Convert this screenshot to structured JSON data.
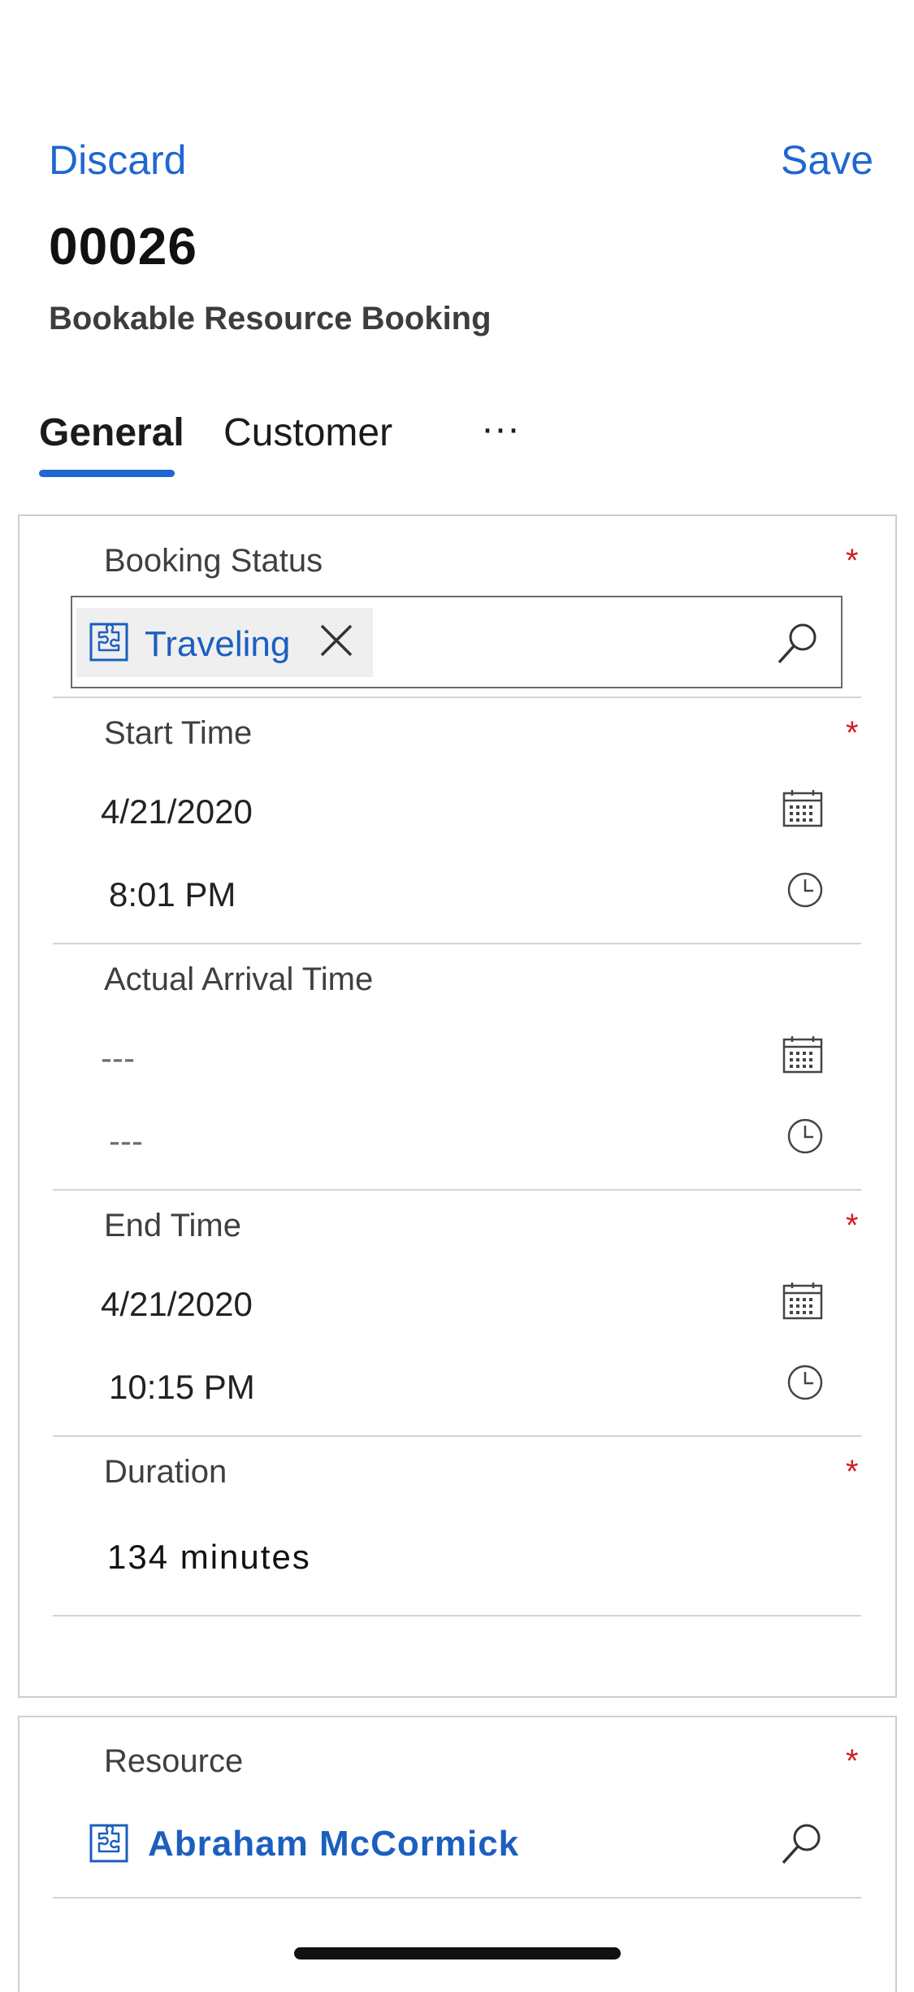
{
  "header": {
    "discard_label": "Discard",
    "save_label": "Save",
    "record_title": "00026",
    "entity_name": "Bookable Resource Booking"
  },
  "tabs": [
    {
      "label": "General",
      "active": true
    },
    {
      "label": "Customer",
      "active": false
    },
    {
      "label": "···",
      "active": false
    }
  ],
  "fields": {
    "booking_status": {
      "label": "Booking Status",
      "required": "*",
      "value": "Traveling"
    },
    "start_time": {
      "label": "Start Time",
      "required": "*",
      "date": "4/21/2020",
      "time": "8:01 PM"
    },
    "actual_arrival_time": {
      "label": "Actual Arrival Time",
      "date": "---",
      "time": "---"
    },
    "end_time": {
      "label": "End Time",
      "required": "*",
      "date": "4/21/2020",
      "time": "10:15 PM"
    },
    "duration": {
      "label": "Duration",
      "required": "*",
      "value": "134 minutes"
    }
  },
  "resource_section": {
    "resource": {
      "label": "Resource",
      "required": "*",
      "value": "Abraham McCormick"
    }
  },
  "colors": {
    "accent": "#1f67d2",
    "lookup_text": "#1b5fbf",
    "required": "#d21d1d"
  },
  "icons": [
    "puzzle-icon",
    "close-icon",
    "search-icon",
    "calendar-icon",
    "clock-icon"
  ]
}
